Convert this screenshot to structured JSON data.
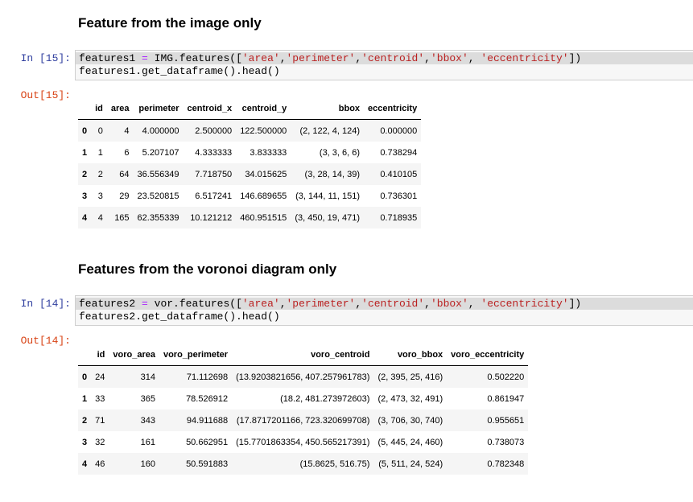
{
  "section1": {
    "heading": "Feature from the image only",
    "in_prompt": "In [15]:",
    "out_prompt": "Out[15]:",
    "code": {
      "line1_var": "features1",
      "line1_op": "=",
      "line1_call": "IMG.features([",
      "args": [
        "'area'",
        "'perimeter'",
        "'centroid'",
        "'bbox'",
        "'eccentricity'"
      ],
      "line1_close": "])",
      "line2": "features1.get_dataframe().head()"
    },
    "table": {
      "columns": [
        "",
        "id",
        "area",
        "perimeter",
        "centroid_x",
        "centroid_y",
        "bbox",
        "eccentricity"
      ],
      "rows": [
        [
          "0",
          "0",
          "4",
          "4.000000",
          "2.500000",
          "122.500000",
          "(2, 122, 4, 124)",
          "0.000000"
        ],
        [
          "1",
          "1",
          "6",
          "5.207107",
          "4.333333",
          "3.833333",
          "(3, 3, 6, 6)",
          "0.738294"
        ],
        [
          "2",
          "2",
          "64",
          "36.556349",
          "7.718750",
          "34.015625",
          "(3, 28, 14, 39)",
          "0.410105"
        ],
        [
          "3",
          "3",
          "29",
          "23.520815",
          "6.517241",
          "146.689655",
          "(3, 144, 11, 151)",
          "0.736301"
        ],
        [
          "4",
          "4",
          "165",
          "62.355339",
          "10.121212",
          "460.951515",
          "(3, 450, 19, 471)",
          "0.718935"
        ]
      ]
    }
  },
  "section2": {
    "heading": "Features from the voronoi diagram only",
    "in_prompt": "In [14]:",
    "out_prompt": "Out[14]:",
    "code": {
      "line1_var": "features2",
      "line1_op": "=",
      "line1_call": "vor.features([",
      "args": [
        "'area'",
        "'perimeter'",
        "'centroid'",
        "'bbox'",
        "'eccentricity'"
      ],
      "line1_close": "])",
      "line2": "features2.get_dataframe().head()"
    },
    "table": {
      "columns": [
        "",
        "id",
        "voro_area",
        "voro_perimeter",
        "voro_centroid",
        "voro_bbox",
        "voro_eccentricity"
      ],
      "rows": [
        [
          "0",
          "24",
          "314",
          "71.112698",
          "(13.9203821656, 407.257961783)",
          "(2, 395, 25, 416)",
          "0.502220"
        ],
        [
          "1",
          "33",
          "365",
          "78.526912",
          "(18.2, 481.273972603)",
          "(2, 473, 32, 491)",
          "0.861947"
        ],
        [
          "2",
          "71",
          "343",
          "94.911688",
          "(17.8717201166, 723.320699708)",
          "(3, 706, 30, 740)",
          "0.955651"
        ],
        [
          "3",
          "32",
          "161",
          "50.662951",
          "(15.7701863354, 450.565217391)",
          "(5, 445, 24, 460)",
          "0.738073"
        ],
        [
          "4",
          "46",
          "160",
          "50.591883",
          "(15.8625, 516.75)",
          "(5, 511, 24, 524)",
          "0.782348"
        ]
      ]
    }
  }
}
